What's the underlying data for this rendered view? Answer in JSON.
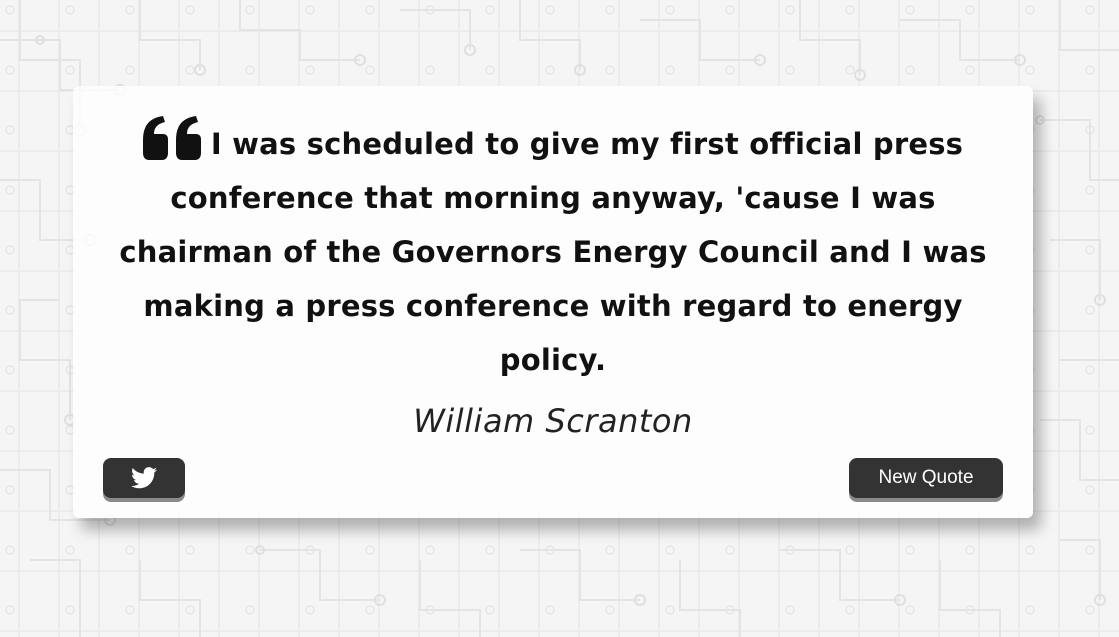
{
  "quote": {
    "text": "I was scheduled to give my first official press conference that morning anyway, 'cause I was chairman of the Governors Energy Council and I was making a press conference with regard to energy policy.",
    "author": "William Scranton",
    "icon": "quote-left-icon"
  },
  "actions": {
    "tweet_icon": "twitter-icon",
    "new_quote_label": "New Quote"
  },
  "colors": {
    "button_bg": "#333333",
    "text": "#111111",
    "card_bg": "#ffffff"
  }
}
